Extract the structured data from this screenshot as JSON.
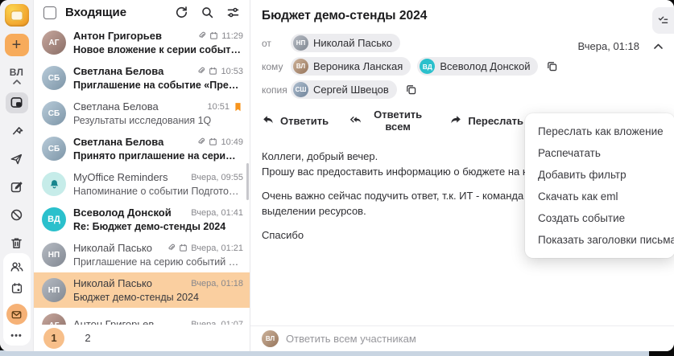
{
  "sidebar": {
    "compose_label": "+",
    "user_initials": "ВЛ"
  },
  "list": {
    "title": "Входящие",
    "items": [
      {
        "from": "Антон Григорьев",
        "subject": "Новое вложение к серии событий «Аналити…",
        "time": "11:29",
        "avatar": "АГ"
      },
      {
        "from": "Светлана Белова",
        "subject": "Приглашение на событие «Предварительно…",
        "time": "10:53",
        "avatar": "СБ"
      },
      {
        "from": "Светлана Белова",
        "subject": "Результаты исследования 1Q",
        "time": "10:51",
        "avatar": "СБ"
      },
      {
        "from": "Светлана Белова",
        "subject": "Принято приглашение на серию событий «…",
        "time": "10:49",
        "avatar": "СБ"
      },
      {
        "from": "MyOffice Reminders",
        "subject": "Напоминание о событии Подготовить отчет…",
        "time": "Вчера, 09:55",
        "avatar": "bell"
      },
      {
        "from": "Всеволод Донской",
        "subject": "Re: Бюджет демо-стенды 2024",
        "time": "Вчера, 01:41",
        "avatar": "ВД"
      },
      {
        "from": "Николай Пасько",
        "subject": "Приглашение на серию событий «Демо стен…",
        "time": "Вчера, 01:21",
        "avatar": "НП"
      },
      {
        "from": "Николай Пасько",
        "subject": "Бюджет демо-стенды 2024",
        "time": "Вчера, 01:18",
        "avatar": "НП"
      },
      {
        "from": "Антон Григорьев",
        "subject": "",
        "time": "Вчера, 01:07",
        "avatar": "АГ"
      }
    ],
    "pagination": {
      "page1": "1",
      "page2": "2"
    }
  },
  "message": {
    "subject": "Бюджет демо-стенды 2024",
    "from_label": "от",
    "from_name": "Николай Пасько",
    "from_avatar": "НП",
    "to_label": "кому",
    "to1_name": "Вероника Ланская",
    "to1_avatar": "ВЛ",
    "to2_name": "Всеволод Донской",
    "to2_avatar": "ВД",
    "cc_label": "копия",
    "cc1_name": "Сергей Швецов",
    "cc1_avatar": "СШ",
    "date": "Вчера, 01:18",
    "actions": {
      "reply": "Ответить",
      "reply_all": "Ответить всем",
      "forward": "Переслать"
    },
    "body": {
      "l1": "Коллеги, добрый вечер.",
      "l2": "Прошу вас предоставить информацию о бюджете на наши демонстраци",
      "l3": "Очень важно сейчас подучить ответ, т.к. ИТ - команда Всеволода, уже",
      "l4": "выделении ресурсов.",
      "l5": "Спасибо"
    },
    "reply_placeholder": "Ответить всем участникам",
    "reply_avatar": "ВЛ"
  },
  "menu": {
    "items": [
      "Переслать как вложение",
      "Распечатать",
      "Добавить фильтр",
      "Скачать как eml",
      "Создать событие",
      "Показать заголовки письма"
    ]
  },
  "colors": {
    "accent_orange": "#F7A44C",
    "selected_row": "#FACFA0",
    "avatar_teal": "#2BC0CC",
    "bookmark_orange": "#F7941D",
    "rail_bg": "#F2F2F4",
    "desktop_strip": "#C9D5E2"
  }
}
